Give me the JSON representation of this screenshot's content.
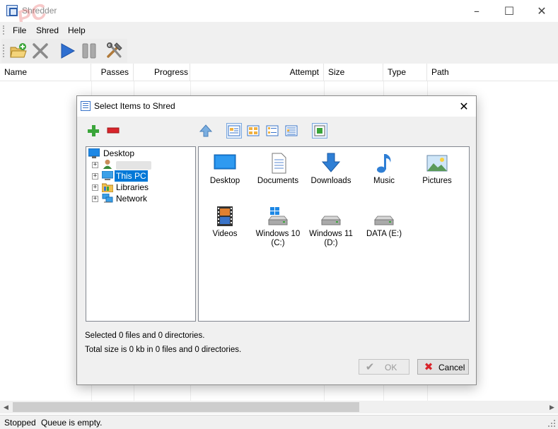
{
  "window": {
    "title": "Shredder",
    "watermark": "PC"
  },
  "menu": {
    "file": "File",
    "shred": "Shred",
    "help": "Help"
  },
  "list": {
    "columns": [
      "Name",
      "Passes",
      "Progress",
      "Attempt",
      "Size",
      "Type",
      "Path"
    ]
  },
  "status": {
    "state": "Stopped",
    "message": "Queue is empty."
  },
  "dialog": {
    "title": "Select Items to Shred",
    "tree": [
      {
        "label": "Desktop"
      },
      {
        "label": ""
      },
      {
        "label": "This PC"
      },
      {
        "label": "Libraries"
      },
      {
        "label": "Network"
      }
    ],
    "items": [
      {
        "label": "Desktop",
        "icon": "desktop-icon"
      },
      {
        "label": "Documents",
        "icon": "documents-icon"
      },
      {
        "label": "Downloads",
        "icon": "downloads-icon"
      },
      {
        "label": "Music",
        "icon": "music-icon"
      },
      {
        "label": "Pictures",
        "icon": "pictures-icon"
      },
      {
        "label": "Videos",
        "icon": "videos-icon"
      },
      {
        "label": "Windows 10\n(C:)",
        "icon": "windows-drive-icon"
      },
      {
        "label": "Windows 11\n(D:)",
        "icon": "drive-icon"
      },
      {
        "label": "DATA (E:)",
        "icon": "drive-icon"
      }
    ],
    "info_selected": "Selected 0 files and 0 directories.",
    "info_size": "Total size is 0 kb in 0 files and 0 directories.",
    "ok_label": "OK",
    "cancel_label": "Cancel"
  },
  "colors": {
    "selection": "#0078d7",
    "accent_blue": "#2f7fd5",
    "cancel_red": "#d9242b",
    "ok_gray": "#a0a0a0"
  }
}
